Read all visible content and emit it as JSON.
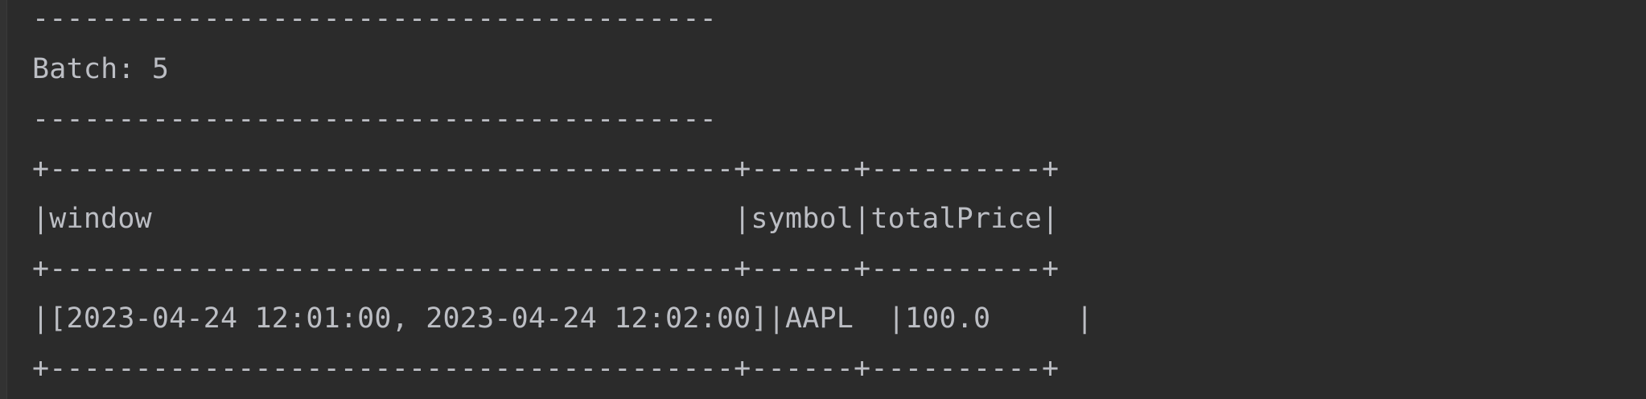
{
  "console": {
    "lines": [
      "----------------------------------------",
      "Batch: 5",
      "----------------------------------------",
      "+----------------------------------------+------+----------+",
      "|window                                  |symbol|totalPrice|",
      "+----------------------------------------+------+----------+",
      "|[2023-04-24 12:01:00, 2023-04-24 12:02:00]|AAPL  |100.0     |",
      "+----------------------------------------+------+----------+"
    ]
  },
  "colors": {
    "background": "#2b2b2b",
    "text": "#bcbec4"
  }
}
